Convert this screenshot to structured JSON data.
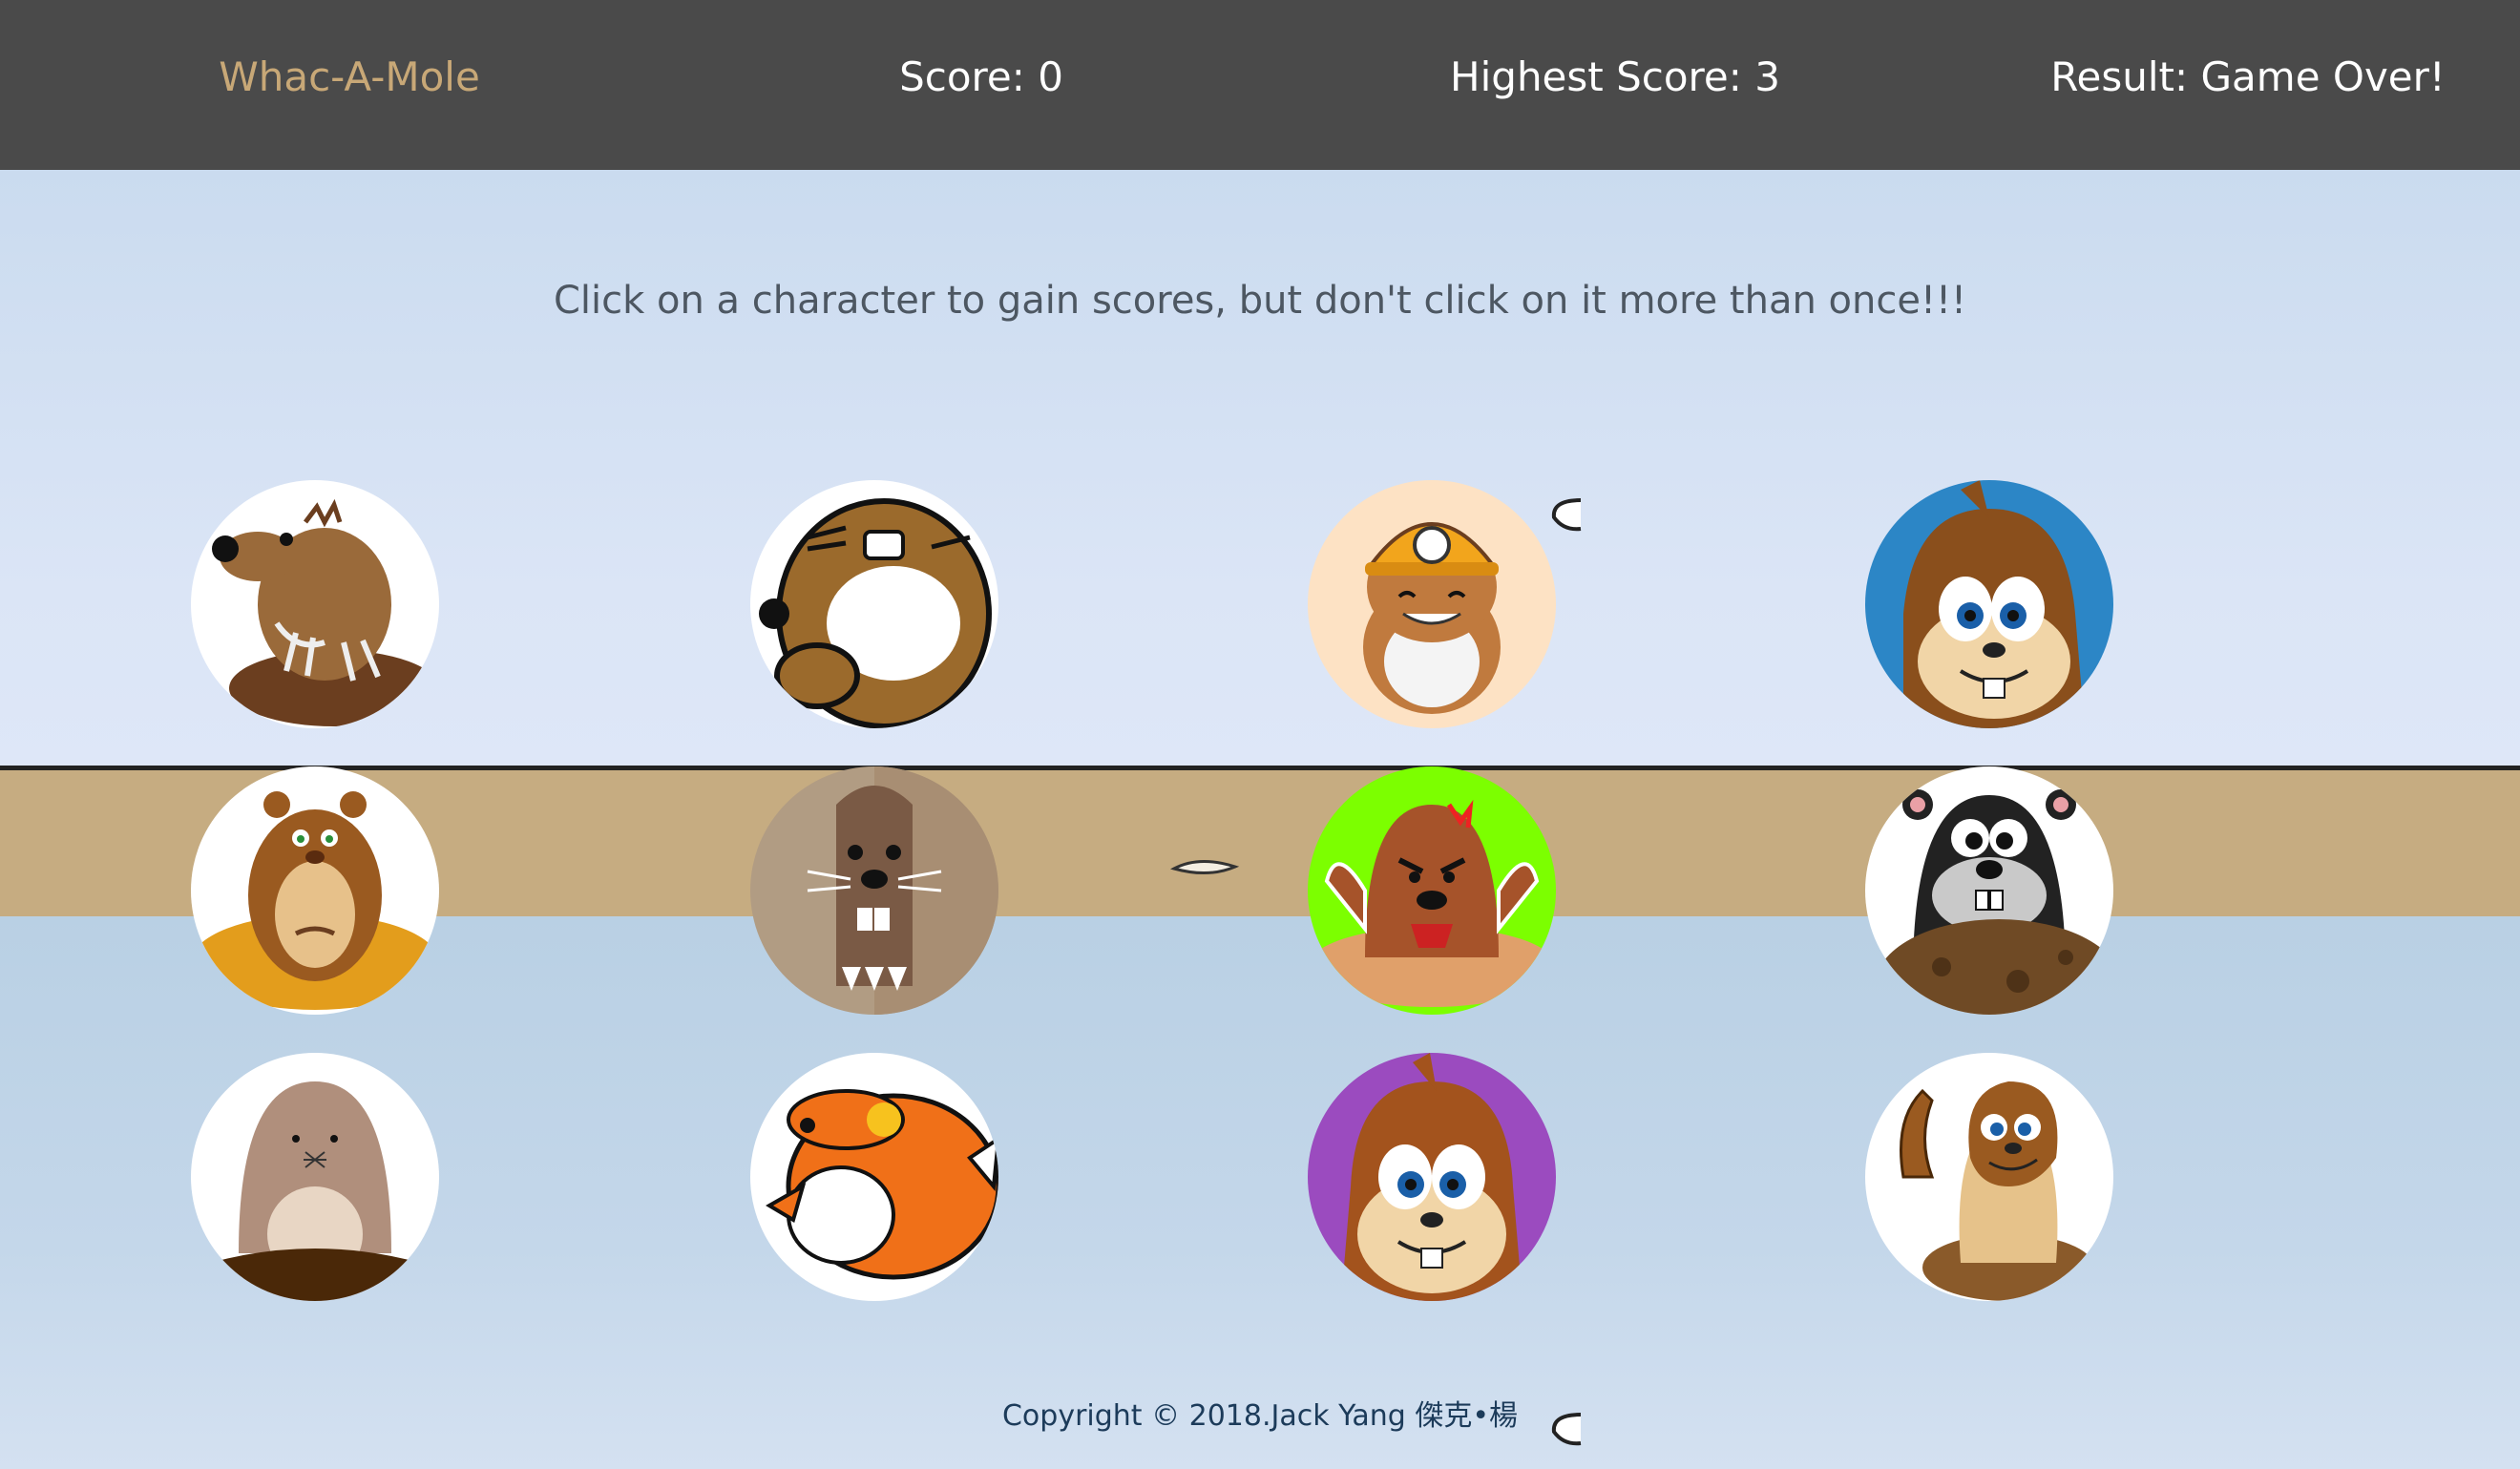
{
  "header": {
    "title": "Whac-A-Mole",
    "score_text": "Score: 0",
    "highest_score_text": "Highest Score: 3",
    "result_text": "Result: Game Over!"
  },
  "instructions": "Click on a character to gain scores, but don't click on it more than once!!!",
  "footer": {
    "copyright": "Copyright © 2018.Jack Yang 傑克•楊"
  },
  "colors": {
    "header_bg": "#4a4a4a",
    "brand": "#c8a877",
    "ground": "#c6ac81",
    "hole_white": "#ffffff",
    "hole_blue": "#2c86c6",
    "hole_green": "#7cff00",
    "hole_purple": "#9b4bbf",
    "hole_peach": "#fde2c4",
    "hole_taupe": "#b19c83"
  },
  "grid": {
    "rows": [
      [
        {
          "character": "mole-claws",
          "background": "white"
        },
        {
          "character": "chubby-beaver",
          "background": "white"
        },
        {
          "character": "miner-hamster",
          "background": "peach"
        },
        {
          "character": "chipmunk-face",
          "background": "blue"
        }
      ],
      [
        {
          "character": "groundhog-in-hole",
          "background": "white"
        },
        {
          "character": "flat-mole",
          "background": "taupe"
        },
        {
          "character": "angry-mole",
          "background": "green"
        },
        {
          "character": "cartoon-mole-dirt",
          "background": "white"
        }
      ],
      [
        {
          "character": "simple-mole",
          "background": "white"
        },
        {
          "character": "orange-hamster",
          "background": "white"
        },
        {
          "character": "chipmunk-face",
          "background": "purple"
        },
        {
          "character": "pointing-gopher",
          "background": "white"
        }
      ]
    ]
  }
}
